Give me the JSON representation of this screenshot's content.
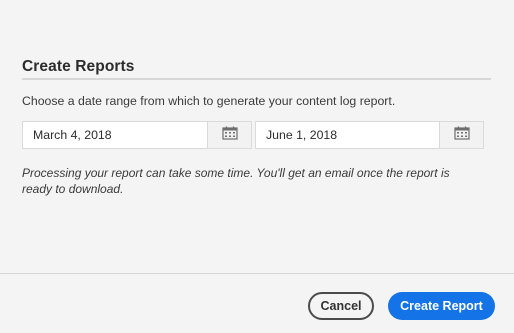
{
  "dialog": {
    "title": "Create Reports",
    "instructions": "Choose a date range from which to generate your content log report.",
    "start_date": {
      "value": "March 4, 2018",
      "icon": "calendar-icon"
    },
    "end_date": {
      "value": "June 1, 2018",
      "icon": "calendar-icon"
    },
    "note": "Processing your report can take some time. You'll get an email once the report is ready to download.",
    "buttons": {
      "cancel_label": "Cancel",
      "create_label": "Create Report"
    }
  },
  "colors": {
    "background": "#f4f4f4",
    "accent": "#1473e6",
    "cancel_border": "#4b4b4b"
  }
}
